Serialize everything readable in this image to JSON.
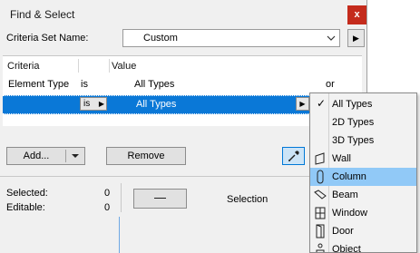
{
  "dialog": {
    "title": "Find & Select",
    "close_glyph": "x",
    "criteria_set_label": "Criteria Set Name:",
    "criteria_set_value": "Custom",
    "play_glyph": "▶"
  },
  "list": {
    "headers": {
      "criteria": "Criteria",
      "value": "Value"
    },
    "rows": [
      {
        "criteria": "Element Type",
        "operator": "is",
        "value": "All Types",
        "conj": "or"
      },
      {
        "operator": "is",
        "value": "All Types"
      }
    ]
  },
  "buttons": {
    "add": "Add...",
    "remove": "Remove",
    "dash": "—",
    "selection": "Selection"
  },
  "stats": {
    "selected_label": "Selected:",
    "selected_value": "0",
    "editable_label": "Editable:",
    "editable_value": "0"
  },
  "menu": {
    "items": [
      {
        "label": "All Types",
        "checked": true,
        "icon": "none"
      },
      {
        "label": "2D Types",
        "icon": "none"
      },
      {
        "label": "3D Types",
        "icon": "none"
      },
      {
        "label": "Wall",
        "icon": "wall-icon"
      },
      {
        "label": "Column",
        "icon": "column-icon",
        "highlighted": true
      },
      {
        "label": "Beam",
        "icon": "beam-icon"
      },
      {
        "label": "Window",
        "icon": "window-icon"
      },
      {
        "label": "Door",
        "icon": "door-icon"
      },
      {
        "label": "Object",
        "icon": "object-icon"
      }
    ],
    "check_glyph": "✓"
  },
  "colors": {
    "selection_blue": "#0a78d7",
    "menu_highlight": "#91c9f7",
    "close_red": "#c42b1c"
  }
}
